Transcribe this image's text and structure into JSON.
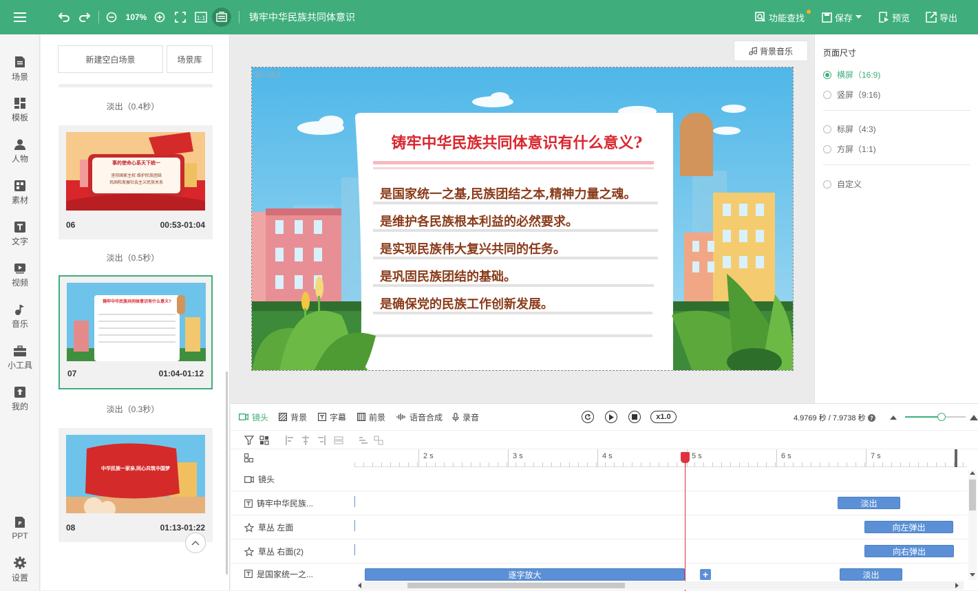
{
  "toolbar": {
    "zoom": "107%",
    "doc_title": "铸牢中华民族共同体意识",
    "find_label": "功能查找",
    "save_label": "保存",
    "preview_label": "预览",
    "export_label": "导出"
  },
  "sidebar": {
    "items": [
      {
        "label": "场景",
        "icon": "scene-icon"
      },
      {
        "label": "模板",
        "icon": "template-icon"
      },
      {
        "label": "人物",
        "icon": "person-icon"
      },
      {
        "label": "素材",
        "icon": "material-icon"
      },
      {
        "label": "文字",
        "icon": "text-icon"
      },
      {
        "label": "视频",
        "icon": "video-icon"
      },
      {
        "label": "音乐",
        "icon": "music-icon"
      },
      {
        "label": "小工具",
        "icon": "toolbox-icon"
      },
      {
        "label": "我的",
        "icon": "upload-icon"
      },
      {
        "label": "PPT",
        "icon": "ppt-icon"
      },
      {
        "label": "设置",
        "icon": "gear-icon"
      }
    ]
  },
  "scenes": {
    "new_scene_label": "新建空白场景",
    "library_label": "场景库",
    "transitions": [
      "淡出（0.4秒）",
      "淡出（0.5秒）",
      "淡出（0.3秒）"
    ],
    "cards": [
      {
        "num": "06",
        "time": "00:53-01:04",
        "title": "事的使命心系天下统一",
        "lines": [
          "坚持国家主权 维护民族团结",
          "巩固和发展社会主义民族关系"
        ]
      },
      {
        "num": "07",
        "time": "01:04-01:12",
        "title": "铸牢中华民族共同体意识有什么意义?"
      },
      {
        "num": "08",
        "time": "01:13-01:22",
        "title": "中华民族一家亲,同心共筑中国梦"
      }
    ]
  },
  "canvas": {
    "bgm_label": "背景音乐",
    "stage_label": "默认镜头",
    "title": "铸牢中华民族共同体意识有什么意义?",
    "lines": [
      "是国家统一之基,民族团结之本,精神力量之魂。",
      "是维护各民族根本利益的必然要求。",
      "是实现民族伟大复兴共同的任务。",
      "是巩固民族团结的基础。",
      "是确保党的民族工作创新发展。"
    ]
  },
  "page_size": {
    "title": "页面尺寸",
    "options": [
      {
        "label": "横屏（16:9)",
        "selected": true
      },
      {
        "label": "竖屏（9:16)",
        "selected": false
      },
      {
        "label": "标屏（4:3)",
        "selected": false
      },
      {
        "label": "方屏（1:1)",
        "selected": false
      },
      {
        "label": "自定义",
        "selected": false
      }
    ]
  },
  "timeline": {
    "tabs": [
      {
        "label": "镜头",
        "icon": "camera-icon",
        "active": true
      },
      {
        "label": "背景",
        "icon": "background-icon"
      },
      {
        "label": "字幕",
        "icon": "subtitle-icon"
      },
      {
        "label": "前景",
        "icon": "foreground-icon"
      },
      {
        "label": "语音合成",
        "icon": "voice-icon"
      },
      {
        "label": "录音",
        "icon": "mic-icon"
      }
    ],
    "speed": "x1.0",
    "time_readout": "4.9769 秒 / 7.9738 秒",
    "ticks": [
      "2 s",
      "3 s",
      "4 s",
      "5 s",
      "6 s",
      "7 s"
    ],
    "tracks": [
      {
        "name": "镜头",
        "icon": "camera-icon",
        "clips": []
      },
      {
        "name": "铸牢中华民族...",
        "icon": "text-icon",
        "clips": [
          {
            "label": "淡出"
          }
        ]
      },
      {
        "name": "草丛 左面",
        "icon": "effect-icon",
        "clips": [
          {
            "label": "向左弹出"
          }
        ]
      },
      {
        "name": "草丛 右面(2)",
        "icon": "effect-icon",
        "clips": [
          {
            "label": "向右弹出"
          }
        ]
      },
      {
        "name": "是国家统一之...",
        "icon": "text-icon",
        "clips": [
          {
            "label": "逐字放大"
          },
          {
            "label": "淡出"
          }
        ]
      }
    ]
  },
  "colors": {
    "accent": "#3fae7c",
    "clip": "#5b90d6",
    "playhead": "#e0323c",
    "title_red": "#d9262f",
    "text_brown": "#8a3b1a"
  }
}
